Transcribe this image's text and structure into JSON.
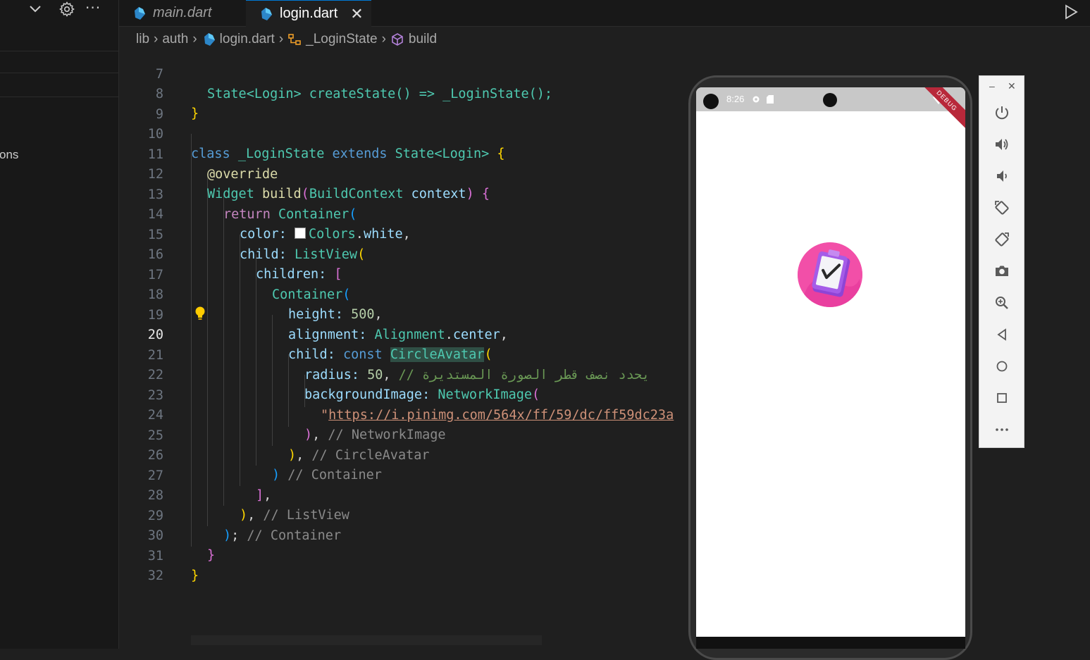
{
  "sidebar": {
    "partial_label": "ons"
  },
  "tabs": [
    {
      "label": "main.dart"
    },
    {
      "label": "login.dart",
      "close": "✕"
    }
  ],
  "breadcrumb": [
    "lib",
    "auth",
    "login.dart",
    "_LoginState",
    "build"
  ],
  "editor": {
    "current_line": 20,
    "line_numbers": [
      "7",
      "8",
      "9",
      "10",
      "11",
      "12",
      "13",
      "14",
      "15",
      "16",
      "17",
      "18",
      "19",
      "20",
      "21",
      "22",
      "23",
      "24",
      "25",
      "26",
      "27",
      "28",
      "29",
      "30",
      "31",
      "32"
    ],
    "lines": {
      "l7": "State<Login> createState() => _LoginState();",
      "l10a": "class",
      "l10b": "_LoginState",
      "l10c": "extends",
      "l10d": "State<Login>",
      "l11": "@override",
      "l12a": "Widget",
      "l12b": "build",
      "l12c": "BuildContext",
      "l12d": "context",
      "l13a": "return",
      "l13b": "Container",
      "l14a": "color:",
      "l14b": "Colors",
      "l14c": "white",
      "l15a": "child:",
      "l15b": "ListView",
      "l16a": "children:",
      "l17a": "Container",
      "l18a": "height:",
      "l18b": "500",
      "l19a": "alignment:",
      "l19b": "Alignment",
      "l19c": "center",
      "l20a": "child:",
      "l20b": "const",
      "l20c": "CircleAvatar",
      "l21a": "radius:",
      "l21b": "50",
      "l21c": "// يحدد نصف قطر الصورة المستديرة",
      "l22a": "backgroundImage:",
      "l22b": "NetworkImage",
      "l23a": "https://i.pinimg.com/564x/ff/59/dc/ff59dc23a",
      "l24c": "// NetworkImage",
      "l25c": "// CircleAvatar",
      "l26c": "// Container",
      "l28c": "// ListView",
      "l29c": "// Container"
    }
  },
  "emulator": {
    "time": "8:26",
    "debug_banner": "DEBUG",
    "avatar_icon": "clipboard-checkmark-image",
    "tool_icons": [
      "power-icon",
      "volume-up-icon",
      "volume-down-icon",
      "rotate-left-icon",
      "rotate-right-icon",
      "camera-icon",
      "zoom-icon",
      "back-icon",
      "home-icon",
      "overview-icon",
      "more-icon"
    ],
    "window_buttons": [
      "–",
      "✕"
    ]
  },
  "colors": {
    "accent": "#0078d4",
    "avatar_bg": "#f24fa8",
    "debug": "#b8283a"
  }
}
